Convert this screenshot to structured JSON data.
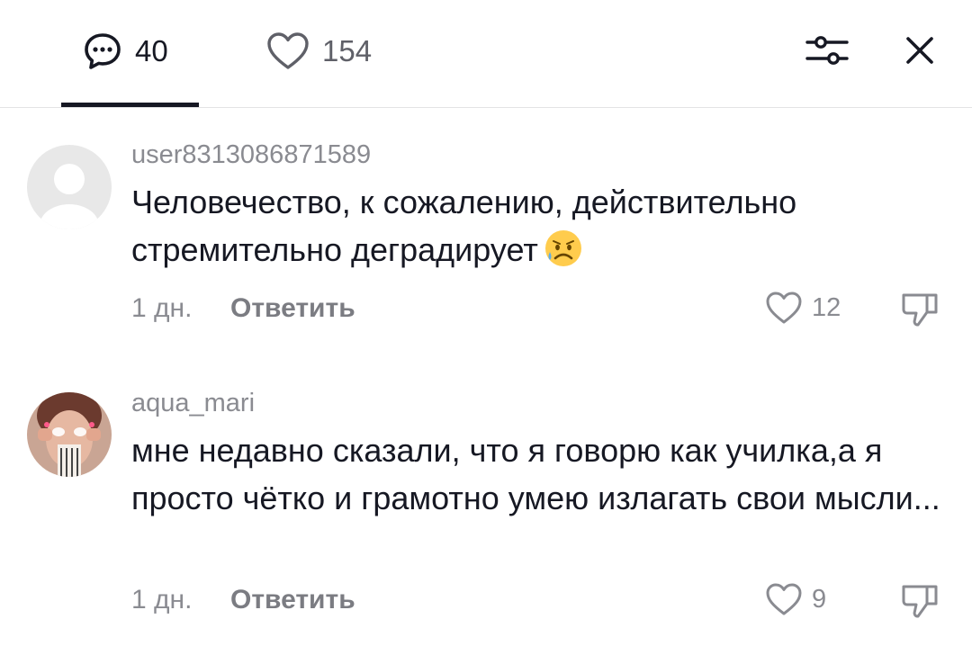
{
  "header": {
    "comments_count": "40",
    "likes_count": "154",
    "comments_icon": "comment-bubble-icon",
    "likes_icon": "heart-icon",
    "filter_icon": "filter-sliders-icon",
    "close_icon": "close-icon"
  },
  "comments": [
    {
      "username": "user8313086871589",
      "text": "Человечество, к сожалению, действительно стремительно деградирует",
      "emoji": "sad-sweat-emoji",
      "time": "1 дн.",
      "reply_label": "Ответить",
      "likes": "12",
      "avatar": "default-avatar"
    },
    {
      "username": "aqua_mari",
      "text": "мне недавно сказали, что я говорю как училка,а я просто чётко и грамотно умею излагать свои мысли...",
      "time": "1 дн.",
      "reply_label": "Ответить",
      "likes": "9",
      "avatar": "user-photo-avatar"
    }
  ],
  "colors": {
    "text_primary": "#161823",
    "text_secondary": "#8a8b91",
    "divider": "#e3e3e4"
  }
}
